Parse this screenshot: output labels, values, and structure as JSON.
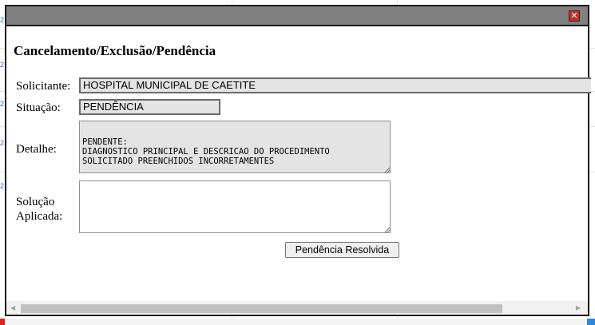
{
  "dialog": {
    "title": "Cancelamento/Exclusão/Pendência",
    "close_glyph": "✕"
  },
  "form": {
    "solicitante_label": "Solicitante:",
    "solicitante_value": "HOSPITAL MUNICIPAL DE CAETITE",
    "situacao_label": "Situação:",
    "situacao_value": "PENDÊNCIA",
    "detalhe_label": "Detalhe:",
    "detalhe_value": "PENDENTE:\nDIAGNOSTICO PRINCIPAL E DESCRICAO DO PROCEDIMENTO\nSOLICITADO PREENCHIDOS INCORRETAMENTES",
    "solucao_label_line1": "Solução",
    "solucao_label_line2": "Aplicada:",
    "solucao_value": "",
    "resolve_button": "Pendência Resolvida"
  },
  "background": {
    "edge_digits": [
      "2",
      "2",
      "2",
      "2",
      "2"
    ]
  },
  "colors": {
    "titlebar": "#808080",
    "close_button": "#b5332b",
    "readonly_field": "#e4e4e4",
    "link_blue": "#3a6fb0"
  },
  "icons": {
    "close": "close-icon",
    "scroll_left": "chevron-left-icon",
    "scroll_right": "chevron-right-icon",
    "resize": "resize-grip-icon"
  }
}
